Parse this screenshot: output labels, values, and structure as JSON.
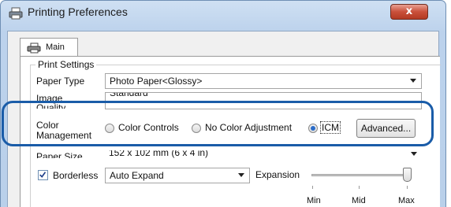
{
  "window": {
    "title": "Printing Preferences",
    "close_glyph": "x"
  },
  "tabs": [
    {
      "label": "Main",
      "icon": "printer-icon"
    }
  ],
  "print_settings": {
    "group_title": "Print Settings",
    "paper_type": {
      "label": "Paper Type",
      "value": "Photo Paper<Glossy>"
    },
    "image_quality": {
      "label_line1": "Image",
      "label_line2": "Quality",
      "value": "Standard"
    },
    "color_management": {
      "label_line1": "Color",
      "label_line2": "Management",
      "options": [
        "Color Controls",
        "No Color Adjustment",
        "ICM"
      ],
      "selected": "ICM",
      "advanced_label": "Advanced..."
    },
    "paper_size": {
      "label": "Paper Size",
      "value": "152 x 102 mm (6 x 4 in)"
    },
    "borderless": {
      "label": "Borderless",
      "checked": true,
      "mode_value": "Auto Expand",
      "expansion_label": "Expansion",
      "expansion_level": 1.0,
      "tick_labels": [
        "Min",
        "Mid",
        "Max"
      ]
    }
  },
  "colors": {
    "highlight": "#1a5ca8",
    "radio_selected": "#2a6cc8"
  }
}
